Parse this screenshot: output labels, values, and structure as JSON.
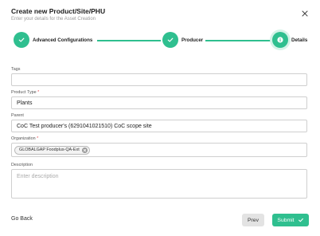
{
  "header": {
    "title": "Create new Product/Site/PHU",
    "subtitle": "Enter your details for the Asset Creation"
  },
  "icons": {
    "close": "close-icon",
    "check": "check-icon",
    "info": "info-icon",
    "chip_remove": "close-circle-icon"
  },
  "colors": {
    "accent": "#2fbf8f",
    "required": "#e5484d"
  },
  "stepper": {
    "steps": [
      {
        "label": "Advanced Configurations",
        "state": "completed"
      },
      {
        "label": "Producer",
        "state": "completed"
      },
      {
        "label": "Details",
        "state": "active"
      }
    ]
  },
  "form": {
    "tags": {
      "label": "Tags",
      "value": ""
    },
    "product_type": {
      "label": "Product Type",
      "required_mark": "*",
      "value": "Plants"
    },
    "parent": {
      "label": "Parent",
      "value": "CoC Test producer's (6291041021510) CoC scope site"
    },
    "organization": {
      "label": "Organization",
      "required_mark": "*",
      "chip": "GLOBALGAP Foodplus-QA-Ext"
    },
    "description": {
      "label": "Description",
      "placeholder": "Enter description"
    }
  },
  "footer": {
    "go_back": "Go Back",
    "prev": "Prev",
    "submit": "Submit"
  }
}
